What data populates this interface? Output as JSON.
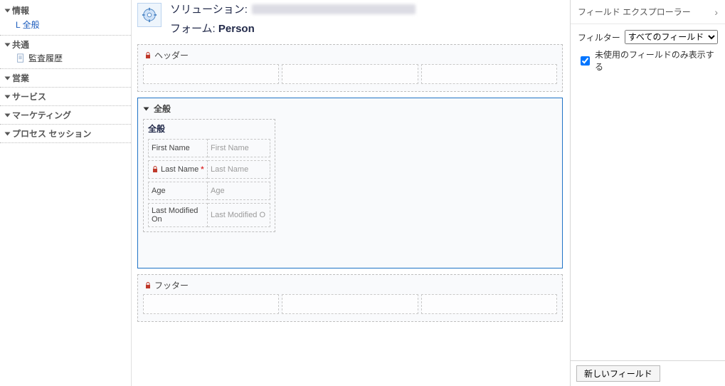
{
  "leftnav": {
    "sections": [
      {
        "label": "情報",
        "expanded": true,
        "sub": [
          {
            "label": "全般"
          }
        ]
      },
      {
        "label": "共通",
        "expanded": true,
        "items": [
          {
            "icon": "doc",
            "label": "監査履歴"
          }
        ]
      },
      {
        "label": "営業",
        "expanded": true
      },
      {
        "label": "サービス",
        "expanded": true
      },
      {
        "label": "マーケティング",
        "expanded": true
      },
      {
        "label": "プロセス セッション",
        "expanded": true
      }
    ]
  },
  "header": {
    "solution_label": "ソリューション:",
    "solution_value_hidden": true,
    "form_label": "フォーム:",
    "form_value": "Person"
  },
  "form": {
    "header_section": {
      "title": "ヘッダー",
      "locked": true,
      "columns": 3
    },
    "general_tab": {
      "title": "全般",
      "section": {
        "title": "全般",
        "fields": [
          {
            "label": "First Name",
            "placeholder": "First Name",
            "locked": false,
            "required": false
          },
          {
            "label": "Last Name",
            "placeholder": "Last Name",
            "locked": true,
            "required": true
          },
          {
            "label": "Age",
            "placeholder": "Age",
            "locked": false,
            "required": false
          },
          {
            "label": "Last Modified On",
            "placeholder": "Last Modified O",
            "locked": false,
            "required": false
          }
        ]
      }
    },
    "footer_section": {
      "title": "フッター",
      "locked": true,
      "columns": 3
    }
  },
  "rightpanel": {
    "title": "フィールド エクスプローラー",
    "filter_label": "フィルター",
    "filter_options": [
      "すべてのフィールド"
    ],
    "filter_selected": "すべてのフィールド",
    "checkbox_label": "未使用のフィールドのみ表示する",
    "checkbox_checked": true,
    "new_field_button": "新しいフィールド"
  }
}
